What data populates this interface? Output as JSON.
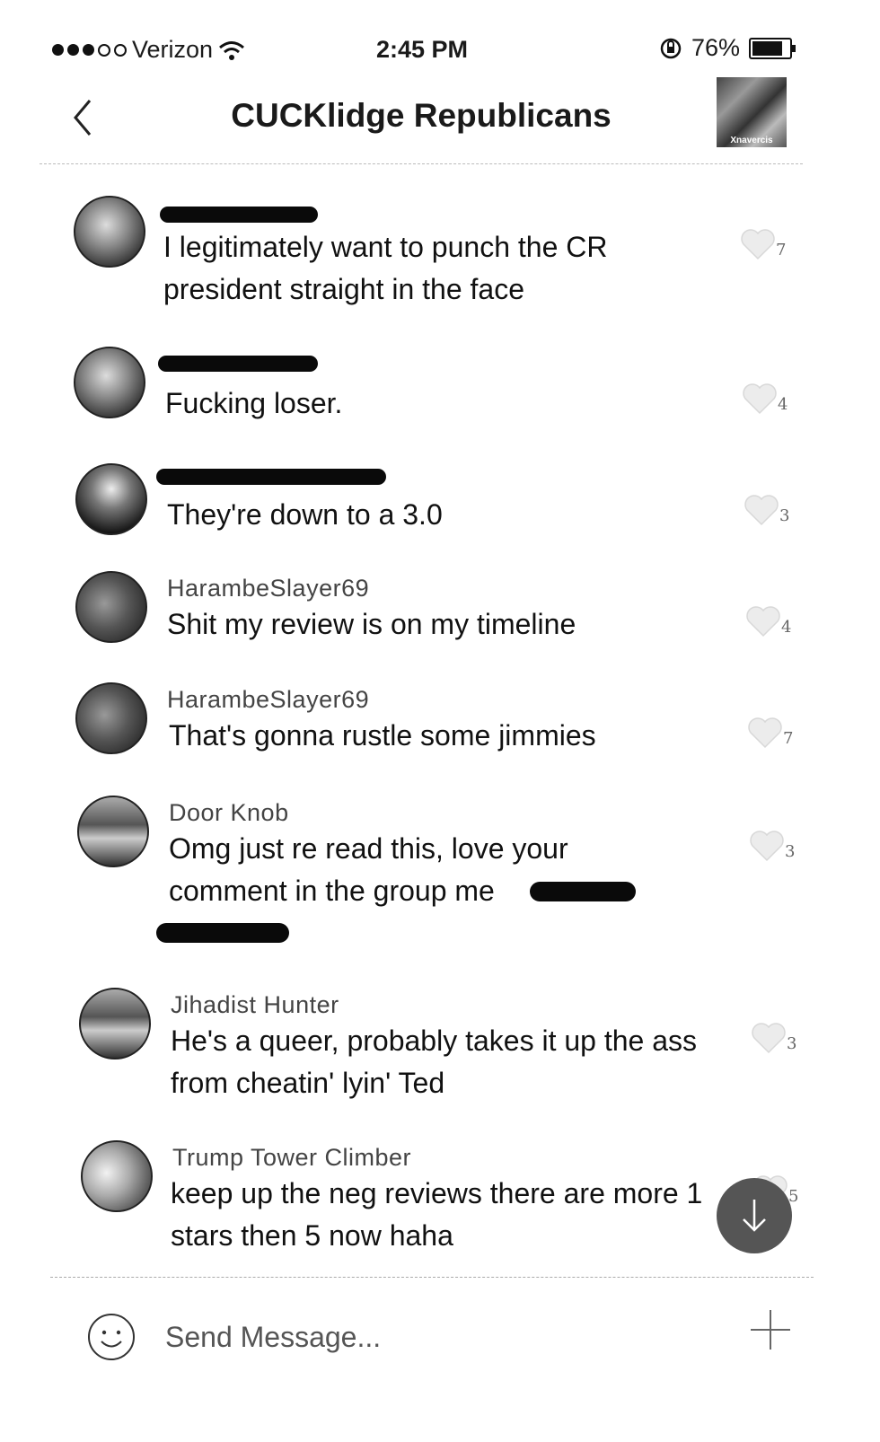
{
  "status": {
    "carrier": "Verizon",
    "time": "2:45 PM",
    "battery": "76%"
  },
  "header": {
    "title": "CUCKlidge Republicans",
    "thumb_caption": "Xnavercis"
  },
  "messages": [
    {
      "author": "",
      "text": "I legitimately want to punch the CR president straight in the face",
      "likes": "7"
    },
    {
      "author": "",
      "text": "Fucking loser.",
      "likes": "4"
    },
    {
      "author": "",
      "text": "They're down to a 3.0",
      "likes": "3"
    },
    {
      "author": "HarambeSlayer69",
      "text": "Shit my review is on my timeline",
      "likes": "4"
    },
    {
      "author": "HarambeSlayer69",
      "text": "That's gonna rustle some jimmies",
      "likes": "7"
    },
    {
      "author": "Door Knob",
      "text": "Omg just re read this, love your comment in the group me",
      "likes": "3"
    },
    {
      "author": "Jihadist Hunter",
      "text": "He's a queer, probably takes it up the ass from cheatin' lyin' Ted",
      "likes": "3"
    },
    {
      "author": "Trump Tower Climber",
      "text": "keep up the neg reviews there are more 1 stars then 5 now haha",
      "likes": "5"
    }
  ],
  "composer": {
    "placeholder": "Send Message..."
  }
}
